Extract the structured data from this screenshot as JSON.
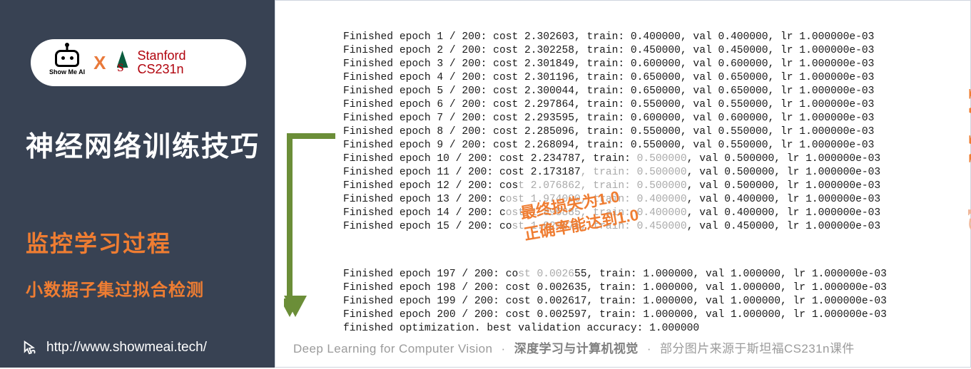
{
  "sidebar": {
    "logo_text": "Show Me AI",
    "x": "X",
    "stanford1": "Stanford",
    "stanford2": "CS231n",
    "title": "神经网络训练技巧",
    "sub1": "监控学习过程",
    "sub2": "小数据子集过拟合检测",
    "url": "http://www.showmeai.tech/"
  },
  "log_lines": [
    "Finished epoch 1 / 200: cost 2.302603, train: 0.400000, val 0.400000, lr 1.000000e-03",
    "Finished epoch 2 / 200: cost 2.302258, train: 0.450000, val 0.450000, lr 1.000000e-03",
    "Finished epoch 3 / 200: cost 2.301849, train: 0.600000, val 0.600000, lr 1.000000e-03",
    "Finished epoch 4 / 200: cost 2.301196, train: 0.650000, val 0.650000, lr 1.000000e-03",
    "Finished epoch 5 / 200: cost 2.300044, train: 0.650000, val 0.650000, lr 1.000000e-03",
    "Finished epoch 6 / 200: cost 2.297864, train: 0.550000, val 0.550000, lr 1.000000e-03",
    "Finished epoch 7 / 200: cost 2.293595, train: 0.600000, val 0.600000, lr 1.000000e-03",
    "Finished epoch 8 / 200: cost 2.285096, train: 0.550000, val 0.550000, lr 1.000000e-03",
    "Finished epoch 9 / 200: cost 2.268094, train: 0.550000, val 0.550000, lr 1.000000e-03"
  ],
  "log_mixed": [
    {
      "a": "Finished epoch 10 / 200: cost 2.234787, train: ",
      "b": "0.500000",
      "c": ", val 0.500000, lr 1.000000e-03"
    },
    {
      "a": "Finished epoch 11 / 200: cost 2.173187",
      "b": ", train: 0.500000",
      "c": ", val 0.500000, lr 1.000000e-03"
    },
    {
      "a": "Finished epoch 12 / 200: cos",
      "b": "t 2.076862, train: 0.500000",
      "c": ", val 0.500000, lr 1.000000e-03"
    },
    {
      "a": "Finished epoch 13 / 200: c",
      "b": "ost 1.974090, train: 0.400000",
      "c": ", val 0.400000, lr 1.000000e-03"
    },
    {
      "a": "Finished epoch 14 / 200: c",
      "b": "ost 1.895885, train: 0.400000",
      "c": ", val 0.400000, lr 1.000000e-03"
    },
    {
      "a": "Finished epoch 15 / 200: co",
      "b": "st 1.820876, train: 0.450000",
      "c": ", val 0.450000, lr 1.000000e-03"
    }
  ],
  "log_bottom": [
    "Finished epoch 197 / 200: cost 0.002655, train: 1.000000, val 1.000000, lr 1.000000e-03",
    "Finished epoch 198 / 200: cost 0.002635, train: 1.000000, val 1.000000, lr 1.000000e-03",
    "Finished epoch 199 / 200: cost 0.002617, train: 1.000000, val 1.000000, lr 1.000000e-03",
    "Finished epoch 200 / 200: cost 0.002597, train: 1.000000, val 1.000000, lr 1.000000e-03",
    "finished optimization. best validation accuracy: 1.000000"
  ],
  "annotation": {
    "l1": "最终损失为1.0",
    "l2": "正确率能达到1.0"
  },
  "watermark": {
    "a": "Show",
    "b": "MeAI"
  },
  "footer": {
    "en": "Deep Learning for Computer Vision",
    "cn": "深度学习与计算机视觉",
    "src": "部分图片来源于斯坦福CS231n课件",
    "dot": "·"
  }
}
